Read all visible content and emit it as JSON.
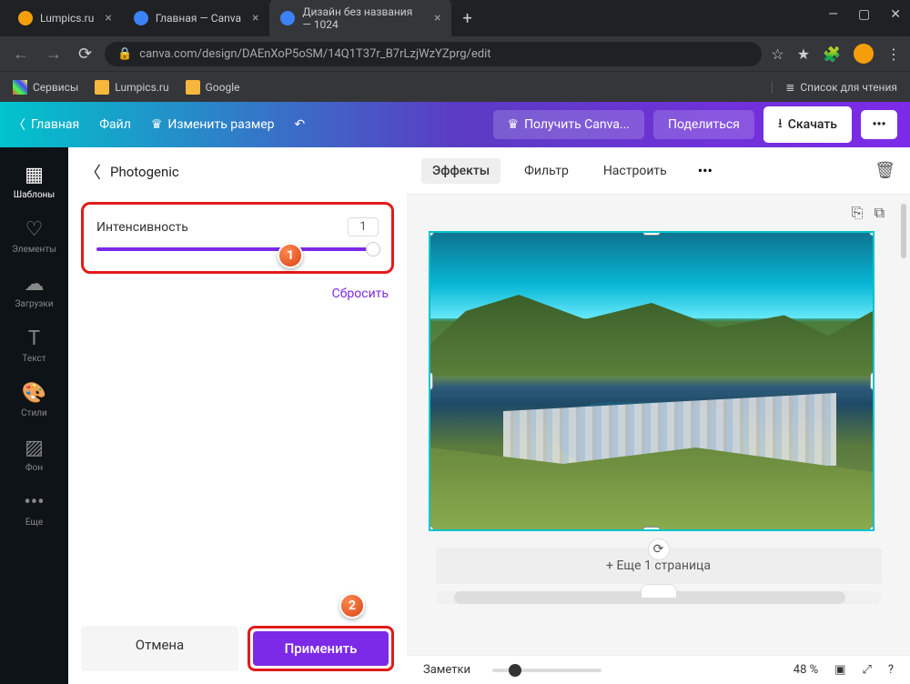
{
  "window": {
    "tabs": [
      {
        "title": "Lumpics.ru",
        "active": false
      },
      {
        "title": "Главная — Canva",
        "active": false
      },
      {
        "title": "Дизайн без названия — 1024",
        "active": true
      }
    ],
    "url": "canva.com/design/DAEnXoP5oSM/14Q1T37r_B7rLzjWzYZprg/edit",
    "bookmarks": {
      "services": "Сервисы",
      "lumpics": "Lumpics.ru",
      "google": "Google",
      "reading_list": "Список для чтения"
    }
  },
  "canva_bar": {
    "home": "Главная",
    "file": "Файл",
    "resize": "Изменить размер",
    "get_pro": "Получить Canva...",
    "share": "Поделиться",
    "download": "Скачать"
  },
  "rail": {
    "templates": "Шаблоны",
    "elements": "Элементы",
    "uploads": "Загрузки",
    "text": "Текст",
    "styles": "Стили",
    "background": "Фон",
    "more": "Еще"
  },
  "panel": {
    "title": "Photogenic",
    "intensity_label": "Интенсивность",
    "intensity_value": "1",
    "reset": "Сбросить",
    "cancel": "Отмена",
    "apply": "Применить"
  },
  "toolbar": {
    "effects": "Эффекты",
    "filter": "Фильтр",
    "adjust": "Настроить"
  },
  "canvas": {
    "add_page": "+ Еще 1 страница"
  },
  "bottom": {
    "notes": "Заметки",
    "zoom": "48 %"
  },
  "steps": {
    "one": "1",
    "two": "2"
  }
}
